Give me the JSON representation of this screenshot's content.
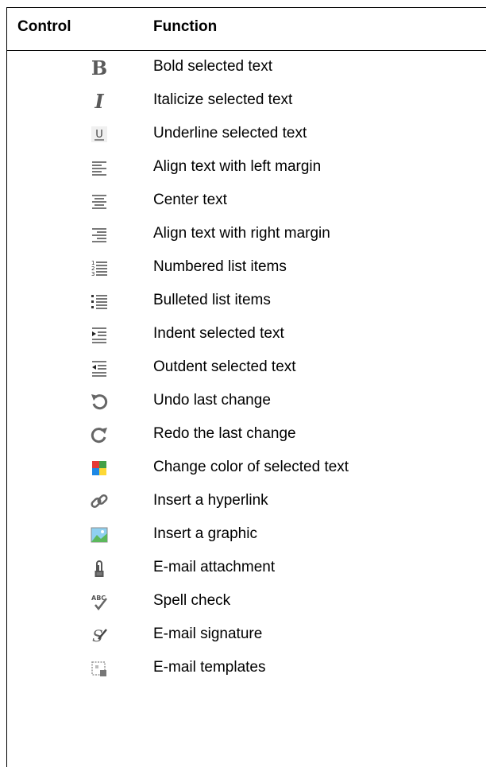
{
  "header": {
    "control": "Control",
    "function": "Function"
  },
  "rows": [
    {
      "icon": "bold-icon",
      "label": "Bold selected text"
    },
    {
      "icon": "italic-icon",
      "label": "Italicize selected text"
    },
    {
      "icon": "underline-icon",
      "label": "Underline selected text"
    },
    {
      "icon": "align-left-icon",
      "label": "Align text with left margin"
    },
    {
      "icon": "align-center-icon",
      "label": "Center text"
    },
    {
      "icon": "align-right-icon",
      "label": "Align text with right margin"
    },
    {
      "icon": "numbered-list-icon",
      "label": "Numbered list items"
    },
    {
      "icon": "bulleted-list-icon",
      "label": "Bulleted list items"
    },
    {
      "icon": "indent-icon",
      "label": "Indent selected text"
    },
    {
      "icon": "outdent-icon",
      "label": "Outdent selected text"
    },
    {
      "icon": "undo-icon",
      "label": "Undo last change"
    },
    {
      "icon": "redo-icon",
      "label": "Redo the last change"
    },
    {
      "icon": "text-color-icon",
      "label": "Change color of selected text"
    },
    {
      "icon": "hyperlink-icon",
      "label": "Insert a hyperlink"
    },
    {
      "icon": "image-icon",
      "label": "Insert a graphic"
    },
    {
      "icon": "paperclip-icon",
      "label": "E-mail attachment"
    },
    {
      "icon": "spell-check-icon",
      "label": "Spell check"
    },
    {
      "icon": "signature-icon",
      "label": "E-mail signature"
    },
    {
      "icon": "template-icon",
      "label": "E-mail templates"
    }
  ]
}
